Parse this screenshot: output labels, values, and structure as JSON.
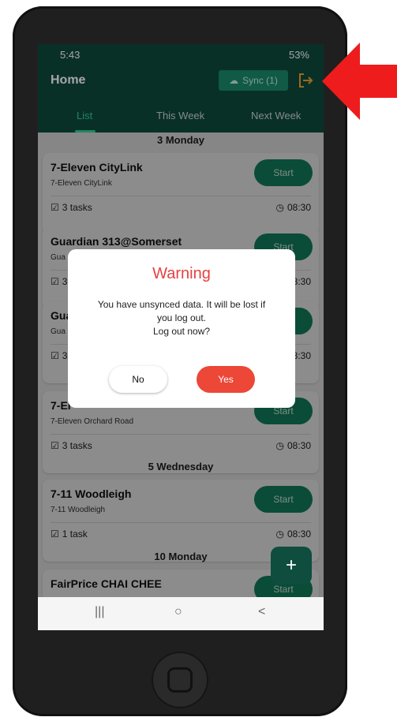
{
  "status_bar": {
    "time": "5:43",
    "right": "53%"
  },
  "header": {
    "title": "Home",
    "sync_label": "Sync (1)"
  },
  "tabs": [
    {
      "label": "List",
      "active": true
    },
    {
      "label": "This Week",
      "active": false
    },
    {
      "label": "Next Week",
      "active": false
    }
  ],
  "days": [
    {
      "label": "3 Monday"
    },
    {
      "label": "5 Wednesday"
    },
    {
      "label": "10 Monday"
    }
  ],
  "cards": [
    {
      "name": "7-Eleven CityLink",
      "sub": "7-Eleven CityLink",
      "start": "Start",
      "tasks": "3 tasks",
      "time": "08:30"
    },
    {
      "name": "Guardian 313@Somerset",
      "sub": "Gua",
      "start": "Start",
      "tasks": "3",
      "time": "08:30"
    },
    {
      "name": "Gua",
      "sub": "Gua",
      "start": "Start",
      "tasks": "3",
      "time": "08:30"
    },
    {
      "name": "7-El",
      "sub": "7-Eleven Orchard Road",
      "start": "Start",
      "tasks": "3 tasks",
      "time": "08:30"
    },
    {
      "name": "7-11 Woodleigh",
      "sub": "7-11 Woodleigh",
      "start": "Start",
      "tasks": "1 task",
      "time": "08:30"
    },
    {
      "name": "FairPrice CHAI CHEE",
      "sub": "",
      "start": "Start",
      "tasks": "",
      "time": ""
    }
  ],
  "dialog": {
    "title": "Warning",
    "message_line1": "You have unsynced data. It will be lost if",
    "message_line2": "you log out.",
    "message_line3": "Log out now?",
    "no_label": "No",
    "yes_label": "Yes"
  },
  "fab": {
    "label": "+"
  },
  "nav": {
    "recent": "|||",
    "home": "○",
    "back": "<"
  },
  "colors": {
    "header_bg": "#0e4a3d",
    "accent": "#138a64",
    "warning": "#e64040",
    "yes_button": "#ec4737",
    "arrow": "#ee1c1c"
  }
}
